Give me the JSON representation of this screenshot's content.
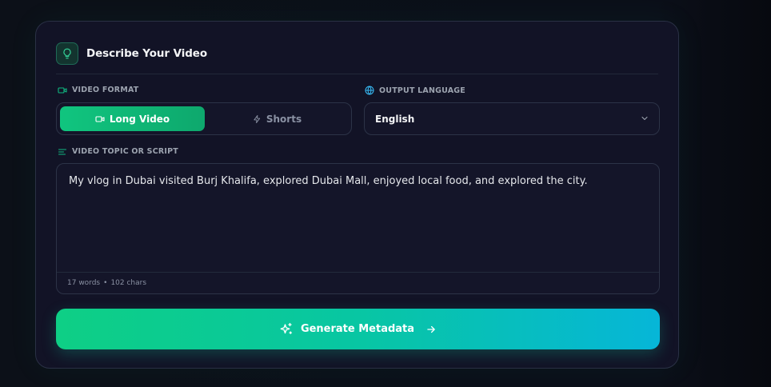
{
  "header": {
    "title": "Describe Your Video",
    "icon": "lightbulb-icon"
  },
  "format": {
    "label": "VIDEO FORMAT",
    "options": [
      {
        "label": "Long Video",
        "icon": "video-icon",
        "selected": true
      },
      {
        "label": "Shorts",
        "icon": "lightning-icon",
        "selected": false
      }
    ]
  },
  "language": {
    "label": "OUTPUT LANGUAGE",
    "value": "English"
  },
  "topic": {
    "label": "VIDEO TOPIC OR SCRIPT",
    "value": "My vlog in Dubai visited Burj Khalifa, explored Dubai Mall, enjoyed local food, and explored the city.",
    "words": "17 words",
    "separator": "•",
    "chars": "102 chars"
  },
  "action": {
    "label": "Generate Metadata"
  },
  "colors": {
    "accent_green": "#10c57f",
    "accent_cyan": "#06b6d8",
    "card_bg": "#121326"
  }
}
